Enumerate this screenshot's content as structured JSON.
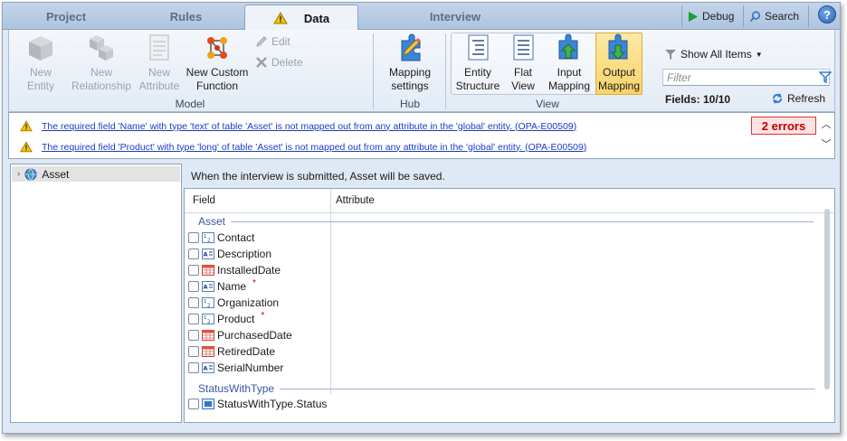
{
  "tabs": [
    {
      "label": "Project",
      "active": false
    },
    {
      "label": "Rules",
      "active": false
    },
    {
      "label": "Data",
      "active": true,
      "icon": "warning-icon"
    },
    {
      "label": "Interview",
      "active": false
    }
  ],
  "toolbar_right": {
    "debug_label": "Debug",
    "search_label": "Search",
    "help_label": "?"
  },
  "ribbon": {
    "model": {
      "group_label": "Model",
      "new_entity": "New\nEntity",
      "new_relationship": "New\nRelationship",
      "new_attribute": "New\nAttribute",
      "new_custom_function": "New Custom\nFunction",
      "edit": "Edit",
      "delete": "Delete"
    },
    "hub": {
      "group_label": "Hub",
      "mapping_settings": "Mapping\nsettings"
    },
    "view": {
      "group_label": "View",
      "entity_structure": "Entity\nStructure",
      "flat_view": "Flat\nView",
      "input_mapping": "Input\nMapping",
      "output_mapping": "Output\nMapping",
      "selected": "Output Mapping"
    },
    "filter": {
      "show_all_items": "Show All Items",
      "filter_placeholder": "Filter",
      "fields_count": "Fields: 10/10",
      "refresh": "Refresh"
    }
  },
  "messages": {
    "items": [
      "The required field 'Name' with type 'text' of table 'Asset' is not mapped out from any attribute in the 'global' entity. (OPA-E00509)",
      "The required field 'Product' with type 'long' of table 'Asset' is not mapped out from any attribute in the 'global' entity. (OPA-E00509)"
    ],
    "error_badge": "2 errors"
  },
  "tree": {
    "items": [
      {
        "label": "Asset",
        "icon": "globe-icon",
        "selected": true
      }
    ]
  },
  "main": {
    "save_note": "When the interview is submitted, Asset will be saved.",
    "columns": {
      "field": "Field",
      "attribute": "Attribute"
    },
    "sections": [
      {
        "title": "Asset"
      },
      {
        "title": "StatusWithType"
      }
    ],
    "rows": [
      {
        "label": "Contact",
        "type_icon": "number-type-icon",
        "required": false
      },
      {
        "label": "Description",
        "type_icon": "text-type-icon",
        "required": false
      },
      {
        "label": "InstalledDate",
        "type_icon": "date-type-icon",
        "required": false
      },
      {
        "label": "Name",
        "type_icon": "text-type-icon",
        "required": true
      },
      {
        "label": "Organization",
        "type_icon": "number-type-icon",
        "required": false
      },
      {
        "label": "Product",
        "type_icon": "number-type-icon",
        "required": true
      },
      {
        "label": "PurchasedDate",
        "type_icon": "date-type-icon",
        "required": false
      },
      {
        "label": "RetiredDate",
        "type_icon": "date-type-icon",
        "required": false
      },
      {
        "label": "SerialNumber",
        "type_icon": "text-type-icon",
        "required": false
      },
      {
        "label": "StatusWithType.Status",
        "type_icon": "list-type-icon",
        "required": false
      }
    ],
    "required_marker": "*"
  }
}
